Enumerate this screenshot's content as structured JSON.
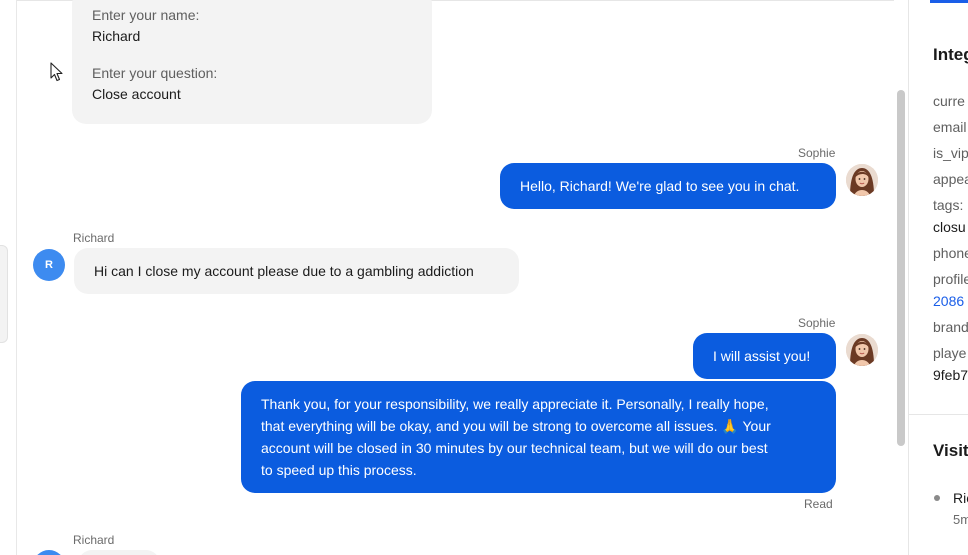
{
  "form": {
    "name_label": "Enter your name:",
    "name_value": "Richard",
    "question_label": "Enter your question:",
    "question_value": "Close account"
  },
  "messages": [
    {
      "sender": "Sophie",
      "text": "Hello, Richard! We're glad to see you in chat."
    },
    {
      "sender": "Richard",
      "avatar_letter": "R",
      "text": "Hi can I close my account please due to a gambling addiction"
    },
    {
      "sender": "Sophie",
      "text": "I will assist you!"
    },
    {
      "text_lines": [
        "Thank you, for your responsibility, we really appreciate it. Personally, I really hope,",
        "that everything will be okay, and you will be strong to overcome all issues. 🙏 Your",
        "account will be closed in 30 minutes by our technical team, but we will do our best",
        "to speed up this process."
      ],
      "status": "Read"
    },
    {
      "sender": "Richard"
    }
  ],
  "right_panel": {
    "title": "Integ",
    "rows": [
      {
        "key": "curre"
      },
      {
        "key": "email"
      },
      {
        "key": "is_vip"
      },
      {
        "key": "appea"
      },
      {
        "key": "tags:",
        "value": "closu"
      },
      {
        "key": "phone"
      },
      {
        "key": "profile",
        "value": "2086"
      },
      {
        "key": "brand"
      },
      {
        "key": "playe",
        "value": "9feb7"
      }
    ],
    "visits_title": "Visit",
    "visit_name": "Ric",
    "visit_time": "5m"
  },
  "colors": {
    "agent_bubble": "#0b5cdf",
    "visitor_bubble": "#f3f3f3",
    "accent": "#1a5ee8"
  }
}
